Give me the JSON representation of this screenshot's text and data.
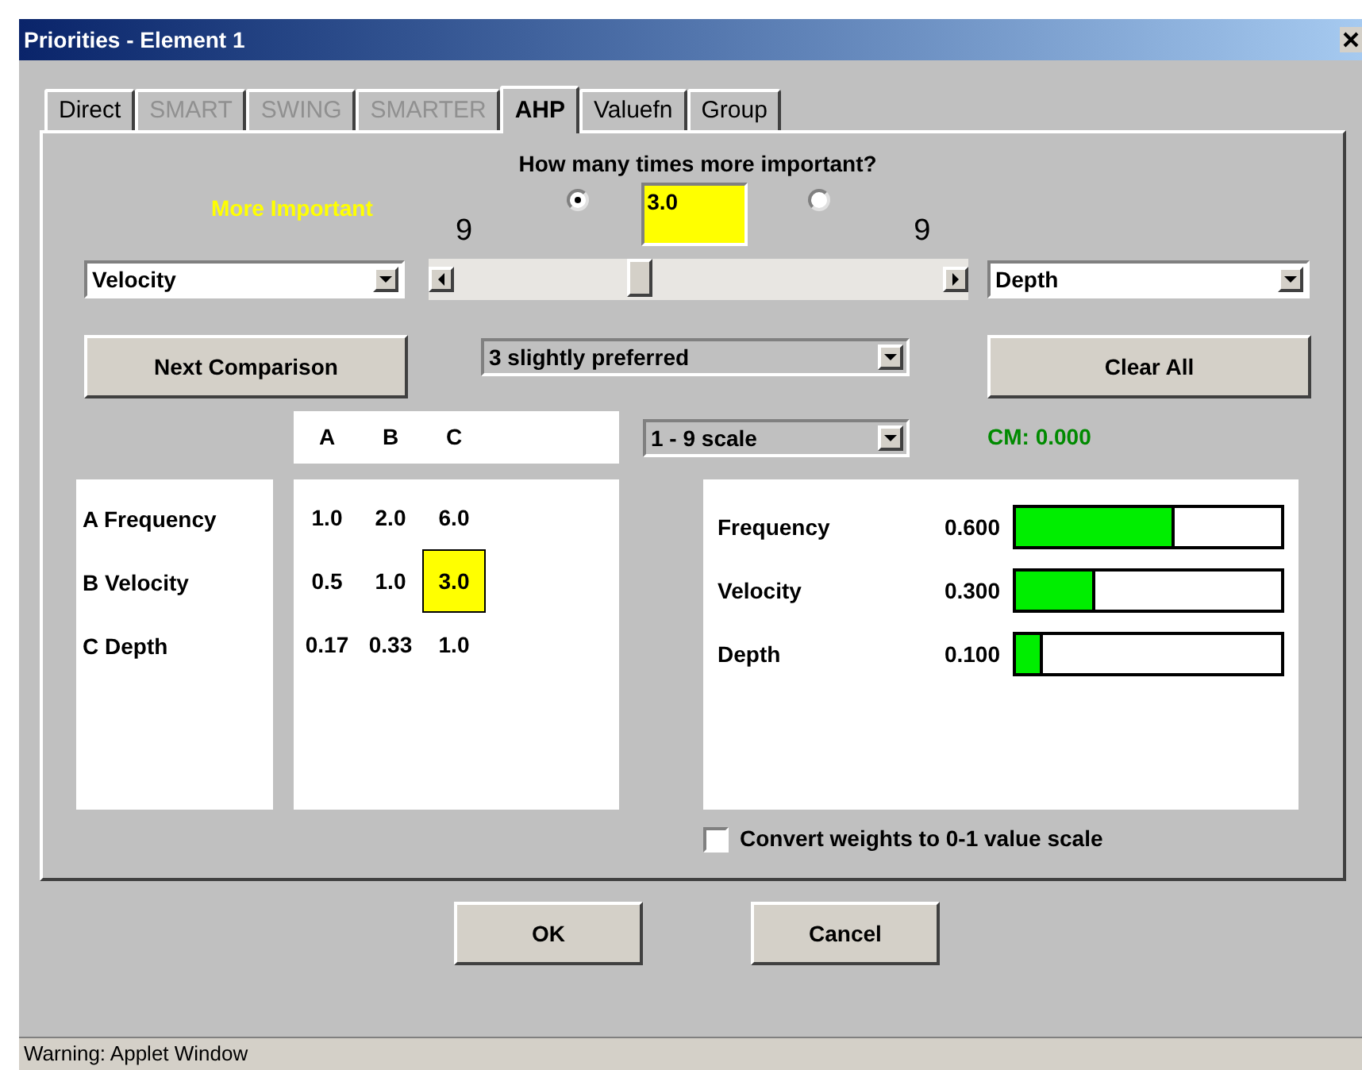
{
  "window": {
    "title": "Priorities - Element 1"
  },
  "tabs": [
    {
      "label": "Direct",
      "selected": false,
      "disabled": false
    },
    {
      "label": "SMART",
      "selected": false,
      "disabled": true
    },
    {
      "label": "SWING",
      "selected": false,
      "disabled": true
    },
    {
      "label": "SMARTER",
      "selected": false,
      "disabled": true
    },
    {
      "label": "AHP",
      "selected": true,
      "disabled": false
    },
    {
      "label": "Valuefn",
      "selected": false,
      "disabled": false
    },
    {
      "label": "Group",
      "selected": false,
      "disabled": false
    }
  ],
  "question": "How many times more important?",
  "more_important_label": "More Important",
  "radios": [
    {
      "selected": true
    },
    {
      "selected": false
    }
  ],
  "ratio_field": {
    "value": "3.0"
  },
  "scale_end_labels": [
    "9",
    "9"
  ],
  "left_criterion": {
    "value": "Velocity"
  },
  "slider": {
    "level": 0.38
  },
  "right_criterion": {
    "value": "Depth"
  },
  "next_button": "Next Comparison",
  "preference_select": {
    "value": "3 slightly preferred"
  },
  "clear_button": "Clear All",
  "scale_select": {
    "value": "1 - 9 scale"
  },
  "consistency": "CM: 0.000",
  "matrix": {
    "columns": [
      "A",
      "B",
      "C"
    ],
    "row_labels": [
      "A Frequency",
      "B Velocity",
      "C Depth"
    ],
    "rows": [
      {
        "cells": [
          {
            "text": "1.0",
            "selected": false
          },
          {
            "text": "2.0",
            "selected": false
          },
          {
            "text": "6.0",
            "selected": false
          }
        ]
      },
      {
        "cells": [
          {
            "text": "0.5",
            "selected": false
          },
          {
            "text": "1.0",
            "selected": false
          },
          {
            "text": "3.0",
            "selected": true
          }
        ]
      },
      {
        "cells": [
          {
            "text": "0.17",
            "selected": false
          },
          {
            "text": "0.33",
            "selected": false
          },
          {
            "text": "1.0",
            "selected": false
          }
        ]
      }
    ]
  },
  "weights": [
    {
      "name": "Frequency",
      "value": "0.600",
      "level": 0.6
    },
    {
      "name": "Velocity",
      "value": "0.300",
      "level": 0.3
    },
    {
      "name": "Depth",
      "value": "0.100",
      "level": 0.1
    }
  ],
  "convert_checkbox": {
    "label": "Convert weights to 0-1 value scale",
    "checked": false
  },
  "dialog_buttons": [
    "OK",
    "Cancel"
  ],
  "status_bar": "Warning: Applet Window"
}
